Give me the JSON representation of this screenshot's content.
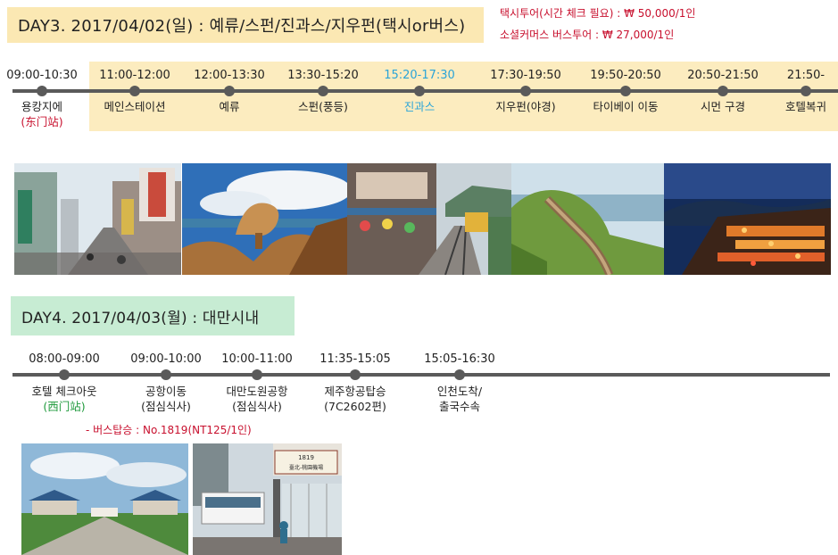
{
  "day3": {
    "title": "DAY3. 2017/04/02(일) : 예류/스펀/진과스/지우펀(택시or버스)",
    "price_taxi": "택시투어(시간 체크 필요) : ₩ 50,000/1인",
    "price_bus": "소셜커머스 버스투어 : ₩ 27,000/1인",
    "stops": [
      {
        "time": "09:00-10:30",
        "label": "용캉지에",
        "sub": "(东门站)"
      },
      {
        "time": "11:00-12:00",
        "label": "메인스테이션"
      },
      {
        "time": "12:00-13:30",
        "label": "예류"
      },
      {
        "time": "13:30-15:20",
        "label": "스펀(풍등)"
      },
      {
        "time": "15:20-17:30",
        "label": "진과스"
      },
      {
        "time": "17:30-19:50",
        "label": "지우펀(야경)"
      },
      {
        "time": "19:50-20:50",
        "label": "타이베이 이동"
      },
      {
        "time": "20:50-21:50",
        "label": "시먼 구경"
      },
      {
        "time": "21:50-",
        "label": "호텔복귀"
      }
    ]
  },
  "day4": {
    "title": "DAY4. 2017/04/03(월) : 대만시내",
    "bus_note": "- 버스탑승 : No.1819(NT125/1인)",
    "stops": [
      {
        "time": "08:00-09:00",
        "label": "호텔 체크아웃",
        "sub": "(西门站)"
      },
      {
        "time": "09:00-10:00",
        "label": "공항이동",
        "sub": "(점심식사)"
      },
      {
        "time": "10:00-11:00",
        "label": "대만도원공항",
        "sub": "(점심식사)"
      },
      {
        "time": "11:35-15:05",
        "label": "제주항공탑승",
        "sub": "(7C2602편)"
      },
      {
        "time": "15:05-16:30",
        "label": "인천도착/",
        "sub": "출국수속"
      }
    ]
  },
  "photos": {
    "bus_sign_number": "1819",
    "bus_sign_text": "臺北-桃園機場"
  },
  "colors": {
    "day3_title_bg": "#fbe8b3",
    "day3_band_bg": "#fcecbf",
    "day4_title_bg": "#c7ecd3",
    "price_red": "#c8102e",
    "active_blue": "#2aa4d8",
    "subway_green": "#1f9a3c",
    "timeline_gray": "#5a5a5a"
  }
}
